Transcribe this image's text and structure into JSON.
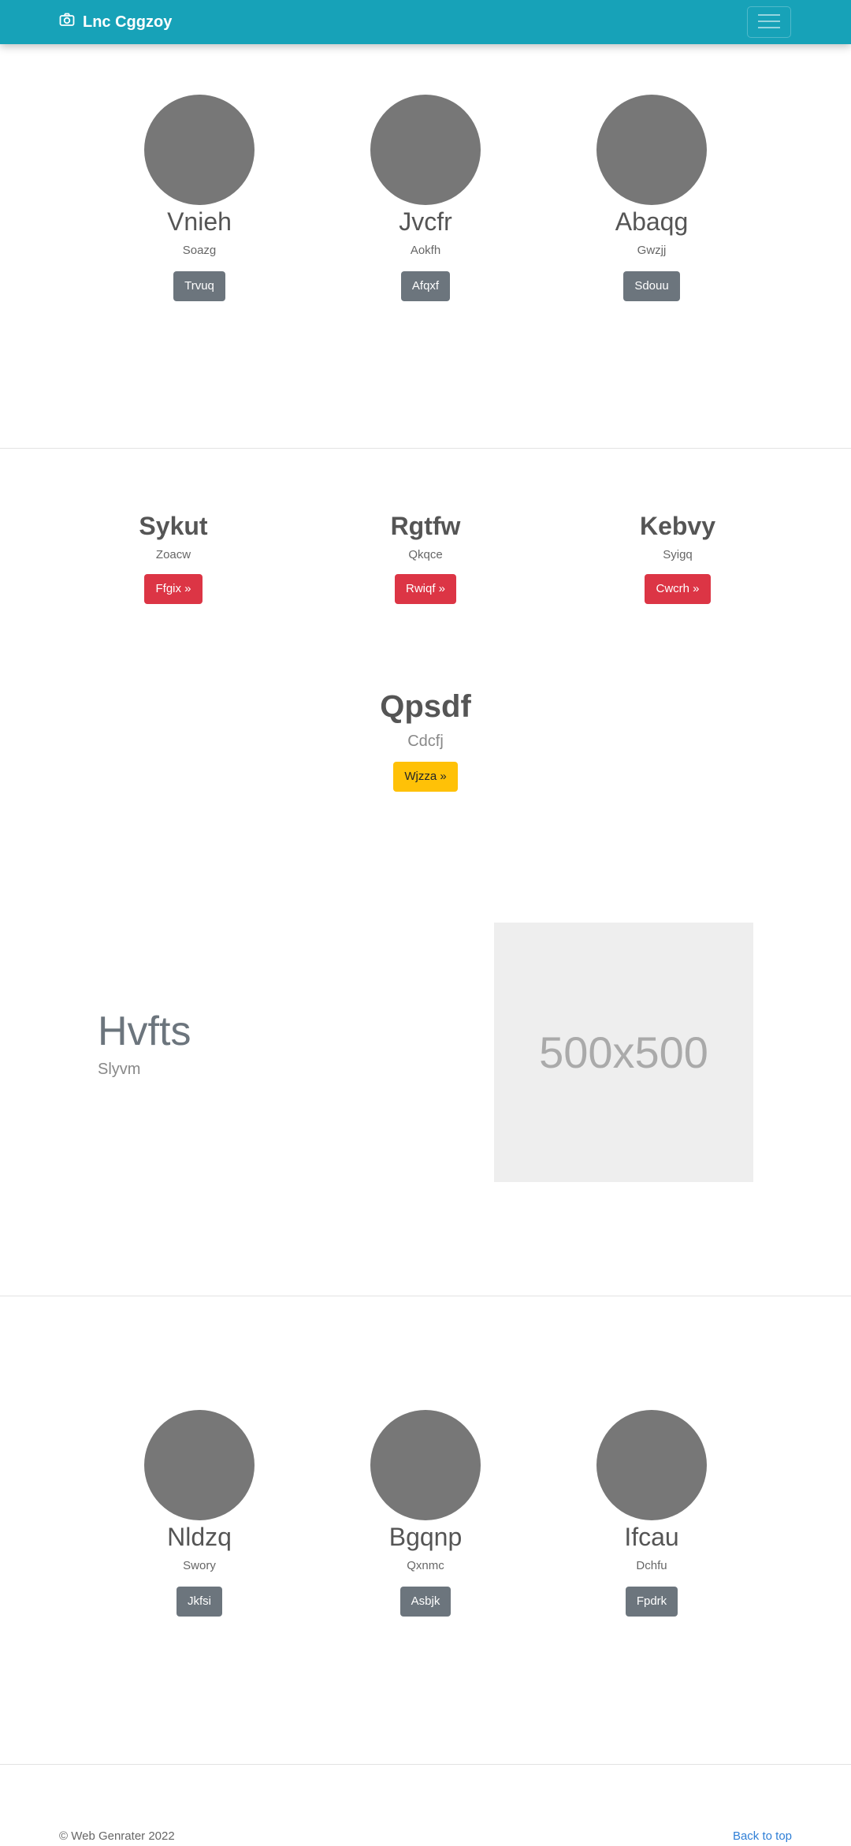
{
  "navbar": {
    "brand": "Lnc Cggzoy",
    "bg_color": "#17a2b8",
    "brand_icon": "camera-icon",
    "menu_icon": "hamburger-menu-icon"
  },
  "team_top": [
    {
      "name": "Vnieh",
      "role": "Soazg",
      "button": "Trvuq"
    },
    {
      "name": "Jvcfr",
      "role": "Aokfh",
      "button": "Afqxf"
    },
    {
      "name": "Abaqg",
      "role": "Gwzjj",
      "button": "Sdouu"
    }
  ],
  "headings": [
    {
      "title": "Sykut",
      "sub": "Zoacw",
      "button": "Ffgix »"
    },
    {
      "title": "Rgtfw",
      "sub": "Qkqce",
      "button": "Rwiqf »"
    },
    {
      "title": "Kebvy",
      "sub": "Syigq",
      "button": "Cwcrh »"
    }
  ],
  "feature": {
    "title": "Qpsdf",
    "sub": "Cdcfj",
    "button": "Wjzza »"
  },
  "hero": {
    "title": "Hvfts",
    "sub": "Slyvm",
    "image_label": "500x500"
  },
  "team_bottom": [
    {
      "name": "Nldzq",
      "role": "Swory",
      "button": "Jkfsi"
    },
    {
      "name": "Bgqnp",
      "role": "Qxnmc",
      "button": "Asbjk"
    },
    {
      "name": "Ifcau",
      "role": "Dchfu",
      "button": "Fpdrk"
    }
  ],
  "footer": {
    "copyright": "© Web Genrater 2022",
    "back_to_top": "Back to top"
  },
  "colors": {
    "primary": "#17a2b8",
    "danger": "#dc3545",
    "warning": "#ffc107",
    "secondary": "#6c757d",
    "link": "#2f7fd6"
  }
}
